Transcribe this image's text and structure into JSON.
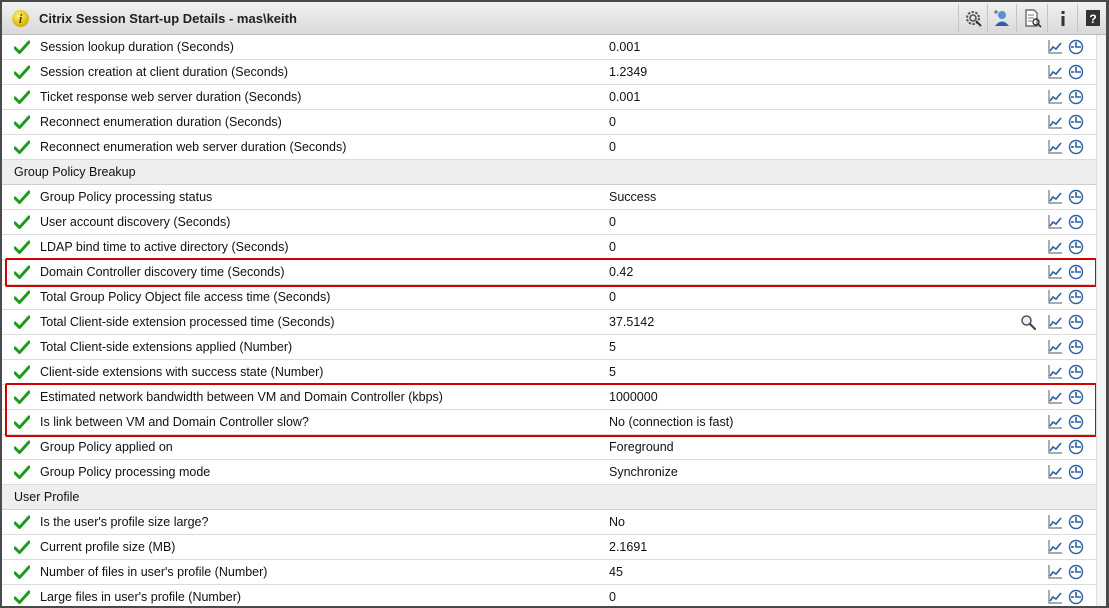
{
  "window": {
    "title": "Citrix Session Start-up Details - mas\\keith"
  },
  "rows": [
    {
      "type": "item",
      "label": "Session lookup duration (Seconds)",
      "value": "0.001"
    },
    {
      "type": "item",
      "label": "Session creation at client duration (Seconds)",
      "value": "1.2349"
    },
    {
      "type": "item",
      "label": "Ticket response web server duration (Seconds)",
      "value": "0.001"
    },
    {
      "type": "item",
      "label": "Reconnect enumeration duration (Seconds)",
      "value": "0"
    },
    {
      "type": "item",
      "label": "Reconnect enumeration web server duration (Seconds)",
      "value": "0"
    },
    {
      "type": "section",
      "label": "Group Policy Breakup"
    },
    {
      "type": "item",
      "label": "Group Policy processing status",
      "value": "Success"
    },
    {
      "type": "item",
      "label": "User account discovery (Seconds)",
      "value": "0"
    },
    {
      "type": "item",
      "label": "LDAP bind time to active directory (Seconds)",
      "value": "0"
    },
    {
      "type": "item",
      "label": "Domain Controller discovery time (Seconds)",
      "value": "0.42",
      "highlight": true
    },
    {
      "type": "item",
      "label": "Total Group Policy Object file access time (Seconds)",
      "value": "0"
    },
    {
      "type": "item",
      "label": "Total Client-side extension processed time (Seconds)",
      "value": "37.5142",
      "zoom": true
    },
    {
      "type": "item",
      "label": "Total Client-side extensions applied (Number)",
      "value": "5"
    },
    {
      "type": "item",
      "label": "Client-side extensions with success state (Number)",
      "value": "5"
    },
    {
      "type": "item",
      "label": "Estimated network bandwidth between VM and Domain Controller (kbps)",
      "value": "1000000",
      "highlight": true
    },
    {
      "type": "item",
      "label": "Is link between VM and Domain Controller slow?",
      "value": "No (connection is fast)",
      "highlight": true
    },
    {
      "type": "item",
      "label": "Group Policy applied on",
      "value": "Foreground"
    },
    {
      "type": "item",
      "label": "Group Policy processing mode",
      "value": "Synchronize"
    },
    {
      "type": "section",
      "label": "User Profile"
    },
    {
      "type": "item",
      "label": "Is the user's profile size large?",
      "value": "No"
    },
    {
      "type": "item",
      "label": "Current profile size (MB)",
      "value": "2.1691"
    },
    {
      "type": "item",
      "label": "Number of files in user's profile (Number)",
      "value": "45"
    },
    {
      "type": "item",
      "label": "Large files in user's profile (Number)",
      "value": "0"
    }
  ],
  "colors": {
    "check": "#1e9a1e",
    "highlight": "#d40000",
    "icon_blue": "#2c5fa8"
  }
}
